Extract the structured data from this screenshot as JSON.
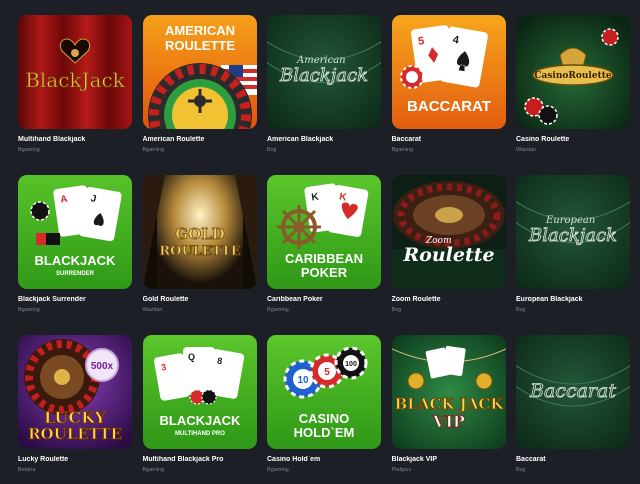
{
  "games": [
    {
      "title": "Multihand Blackjack",
      "provider": "Bgaming",
      "art_text": [
        "BlackJack"
      ]
    },
    {
      "title": "American Roulette",
      "provider": "Bgaming",
      "art_text": [
        "AMERICAN",
        "ROULETTE"
      ]
    },
    {
      "title": "American Blackjack",
      "provider": "Bsg",
      "art_text": [
        "American",
        "Blackjack"
      ]
    },
    {
      "title": "Baccarat",
      "provider": "Bgaming",
      "art_text": [
        "BACCARAT"
      ]
    },
    {
      "title": "Casino Roulette",
      "provider": "Wazdan",
      "art_text": [
        "CasinoRoulette"
      ]
    },
    {
      "title": "Blackjack Surrender",
      "provider": "Bgaming",
      "art_text": [
        "BLACKJACK",
        "SURRENDER"
      ]
    },
    {
      "title": "Gold Roulette",
      "provider": "Wazdan",
      "art_text": [
        "GOLD",
        "ROULETTE"
      ]
    },
    {
      "title": "Caribbean Poker",
      "provider": "Bgaming",
      "art_text": [
        "CARIBBEAN",
        "POKER"
      ]
    },
    {
      "title": "Zoom Roulette",
      "provider": "Bsg",
      "art_text": [
        "Zoom",
        "Roulette"
      ]
    },
    {
      "title": "European Blackjack",
      "provider": "Bsg",
      "art_text": [
        "European",
        "Blackjack"
      ]
    },
    {
      "title": "Lucky Roulette",
      "provider": "Belatra",
      "art_text": [
        "LUCKY",
        "ROULETTE",
        "500x"
      ]
    },
    {
      "title": "Multihand Blackjack Pro",
      "provider": "Bgaming",
      "art_text": [
        "BLACKJACK",
        "MULTIHAND PRO"
      ]
    },
    {
      "title": "Casino Hold`em",
      "provider": "Bgaming",
      "art_text": [
        "CASINO",
        "HOLD`EM"
      ]
    },
    {
      "title": "Blackjack VIP",
      "provider": "Platipus",
      "art_text": [
        "BLACK JACK",
        "VIP"
      ]
    },
    {
      "title": "Baccarat",
      "provider": "Bsg",
      "art_text": [
        "Baccarat"
      ]
    }
  ],
  "colors": {
    "background": "#1c1f26",
    "title": "#ffffff",
    "provider": "#7d828c",
    "green_card": "#3fae1e",
    "orange_card": "#f07a12",
    "felt_green": "#123a22",
    "red_curtain": "#8e0d0d",
    "purple": "#4b1a6e"
  }
}
